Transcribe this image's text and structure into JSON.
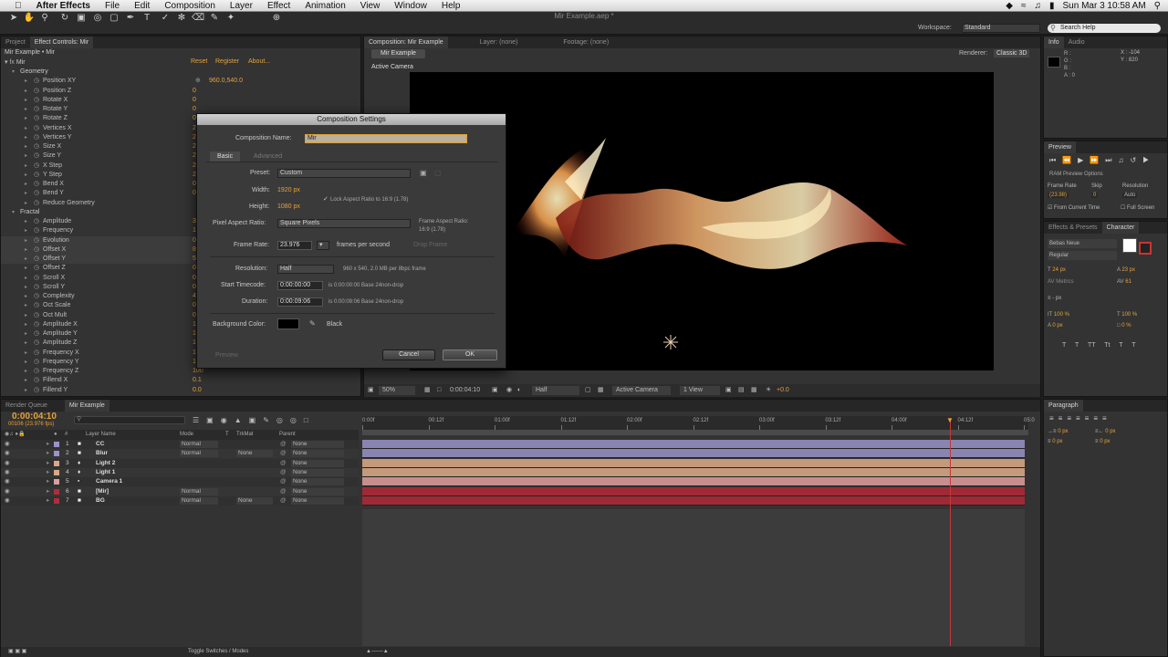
{
  "menubar": {
    "apple": "",
    "app_name": "After Effects",
    "items": [
      "File",
      "Edit",
      "Composition",
      "Layer",
      "Effect",
      "Animation",
      "View",
      "Window",
      "Help"
    ],
    "clock": "Sun Mar 3  10:58 AM",
    "window_title": "Mir Example.aep *"
  },
  "toolbar": {
    "workspace_label": "Workspace:",
    "workspace_value": "Standard",
    "search_placeholder": "Search Help"
  },
  "effect_controls": {
    "tab_project": "Project",
    "tab_effect_controls": "Effect Controls: Mir",
    "header": "Mir Example • Mir",
    "effect_name": "Mir",
    "reset": "Reset",
    "register": "Register",
    "about": "About...",
    "rows": [
      {
        "name": "Geometry",
        "val": "",
        "indent": 1,
        "group": true
      },
      {
        "name": "Position XY",
        "val": "960.0,540.0",
        "indent": 3
      },
      {
        "name": "Position Z",
        "val": "0",
        "indent": 3
      },
      {
        "name": "Rotate X",
        "val": "0",
        "indent": 3
      },
      {
        "name": "Rotate Y",
        "val": "0",
        "indent": 3
      },
      {
        "name": "Rotate Z",
        "val": "0",
        "indent": 3
      },
      {
        "name": "Vertices X",
        "val": "2",
        "indent": 3
      },
      {
        "name": "Vertices Y",
        "val": "2",
        "indent": 3
      },
      {
        "name": "Size X",
        "val": "2",
        "indent": 3
      },
      {
        "name": "Size Y",
        "val": "2",
        "indent": 3
      },
      {
        "name": "X Step",
        "val": "2",
        "indent": 3
      },
      {
        "name": "Y Step",
        "val": "2",
        "indent": 3
      },
      {
        "name": "Bend X",
        "val": "0",
        "indent": 3
      },
      {
        "name": "Bend Y",
        "val": "0",
        "indent": 3
      },
      {
        "name": "Reduce Geometry",
        "val": "",
        "indent": 3
      },
      {
        "name": "Fractal",
        "val": "",
        "indent": 1,
        "group": true
      },
      {
        "name": "Amplitude",
        "val": "3",
        "indent": 3
      },
      {
        "name": "Frequency",
        "val": "1",
        "indent": 3
      },
      {
        "name": "Evolution",
        "val": "0",
        "indent": 3
      },
      {
        "name": "Offset X",
        "val": "8",
        "indent": 3
      },
      {
        "name": "Offset Y",
        "val": "5",
        "indent": 3
      },
      {
        "name": "Offset Z",
        "val": "0",
        "indent": 3
      },
      {
        "name": "Scroll X",
        "val": "0",
        "indent": 3
      },
      {
        "name": "Scroll Y",
        "val": "0",
        "indent": 3
      },
      {
        "name": "Complexity",
        "val": "4",
        "indent": 3
      },
      {
        "name": "Oct Scale",
        "val": "0",
        "indent": 3
      },
      {
        "name": "Oct Mult",
        "val": "0",
        "indent": 3
      },
      {
        "name": "Amplitude X",
        "val": "1",
        "indent": 3
      },
      {
        "name": "Amplitude Y",
        "val": "1",
        "indent": 3
      },
      {
        "name": "Amplitude Z",
        "val": "1",
        "indent": 3
      },
      {
        "name": "Frequency X",
        "val": "1",
        "indent": 3
      },
      {
        "name": "Frequency Y",
        "val": "1",
        "indent": 3
      },
      {
        "name": "Frequency Z",
        "val": "100",
        "indent": 3
      },
      {
        "name": "Fillend X",
        "val": "0.1",
        "indent": 3
      },
      {
        "name": "Fillend Y",
        "val": "0.0",
        "indent": 3
      }
    ]
  },
  "composition": {
    "tab": "Composition: Mir Example",
    "layer_tab": "Layer: (none)",
    "footage_tab": "Footage: (none)",
    "breadcrumb": "Mir Example",
    "renderer_label": "Renderer:",
    "renderer_value": "Classic 3D",
    "active_camera": "Active Camera",
    "footer": {
      "zoom": "50%",
      "timecode": "0:00:04:10",
      "resolution": "Half",
      "view": "Active Camera",
      "views": "1 View",
      "exposure": "+0.0"
    }
  },
  "dialog": {
    "title": "Composition Settings",
    "comp_name_label": "Composition Name:",
    "comp_name_value": "Mir",
    "tab_basic": "Basic",
    "tab_advanced": "Advanced",
    "preset_label": "Preset:",
    "preset_value": "Custom",
    "width_label": "Width:",
    "width_value": "1920 px",
    "height_label": "Height:",
    "height_value": "1080 px",
    "lock_label": "Lock Aspect Ratio to 16:9 (1.78)",
    "par_label": "Pixel Aspect Ratio:",
    "par_value": "Square Pixels",
    "far_label": "Frame Aspect Ratio:",
    "far_value": "16:9 (1.78)",
    "fps_label": "Frame Rate:",
    "fps_value": "23.976",
    "fps_unit": "frames per second",
    "drop_frame": "Drop Frame",
    "res_label": "Resolution:",
    "res_value": "Half",
    "res_info": "960 x 540, 2.0 MB per 8bpc frame",
    "start_label": "Start Timecode:",
    "start_value": "0:00:00:00",
    "start_info": "is 0:00:00:00  Base 24non-drop",
    "dur_label": "Duration:",
    "dur_value": "0:00:09:06",
    "dur_info": "is 0:00:09:06  Base 24non-drop",
    "bg_label": "Background Color:",
    "bg_name": "Black",
    "preview": "Preview",
    "cancel": "Cancel",
    "ok": "OK"
  },
  "right_panel": {
    "info_tab": "Info",
    "audio_tab": "Audio",
    "info_rgb": [
      "R :",
      "G :",
      "B :",
      "A : 0"
    ],
    "info_x": "X : -104",
    "info_y": "Y : 820",
    "preview_tab": "Preview",
    "ram_preview": "RAM Preview Options",
    "frame_rate_label": "Frame Rate",
    "skip_label": "Skip",
    "resolution_label": "Resolution",
    "frame_rate_value": "(23.98)",
    "skip_value": "0",
    "resolution_value": "Auto",
    "from_current": "From Current Time",
    "full_screen": "Full Screen",
    "effects_tab": "Effects & Presets",
    "character_tab": "Character",
    "font": "Bebas Neue",
    "style": "Regular",
    "size": "24 px",
    "leading": "23 px",
    "kerning": "Metrics",
    "tracking": "61",
    "stroke": "- px",
    "vscale": "100 %",
    "hscale": "100 %",
    "baseline": "0 px",
    "tsume": "0 %",
    "text_styles": [
      "T",
      "T",
      "TT",
      "Tt",
      "T",
      "T"
    ],
    "paragraph_tab": "Paragraph",
    "para_values": [
      "0 px",
      "0 px",
      "0 px",
      "0 px",
      "0 px"
    ]
  },
  "timeline": {
    "render_queue_tab": "Render Queue",
    "comp_tab": "Mir Example",
    "timecode": "0:00:04:10",
    "frame_info": "00106 (23.976 fps)",
    "col_layer": "Layer Name",
    "col_mode": "Mode",
    "col_t": "T",
    "col_trkmat": "TrkMat",
    "col_parent": "Parent",
    "ruler": [
      "0:00f",
      "00:12f",
      "01:00f",
      "01:12f",
      "02:00f",
      "02:12f",
      "03:00f",
      "03:12f",
      "04:00f",
      "04:12f",
      "05:0"
    ],
    "playhead_fraction": 0.887,
    "toggle": "Toggle Switches / Modes",
    "layers": [
      {
        "num": "1",
        "name": "CC",
        "color": "#9a92c8",
        "mode": "Normal",
        "trkmat": "",
        "parent": "None",
        "bar": "#8984b0",
        "icon": "solid"
      },
      {
        "num": "2",
        "name": "Blur",
        "color": "#9a92c8",
        "mode": "Normal",
        "trkmat": "None",
        "parent": "None",
        "bar": "#8984b0",
        "icon": "solid"
      },
      {
        "num": "3",
        "name": "Light 2",
        "color": "#d8a887",
        "mode": "",
        "trkmat": "",
        "parent": "None",
        "bar": "#c49a7c",
        "icon": "light"
      },
      {
        "num": "4",
        "name": "Light 1",
        "color": "#d8a887",
        "mode": "",
        "trkmat": "",
        "parent": "None",
        "bar": "#c49a7c",
        "icon": "light"
      },
      {
        "num": "5",
        "name": "Camera 1",
        "color": "#d8a0a0",
        "mode": "",
        "trkmat": "",
        "parent": "None",
        "bar": "#c78e8e",
        "icon": "camera"
      },
      {
        "num": "6",
        "name": "[Mir]",
        "color": "#b02c3a",
        "mode": "Normal",
        "trkmat": "",
        "parent": "None",
        "bar": "#9f2a36",
        "icon": "solid"
      },
      {
        "num": "7",
        "name": "BG",
        "color": "#b02c3a",
        "mode": "Normal",
        "trkmat": "None",
        "parent": "None",
        "bar": "#9f2a36",
        "icon": "solid"
      }
    ]
  },
  "colors": {
    "accent_orange": "#e5a23a",
    "playhead": "#c13a3a",
    "panel_bg": "#333333"
  }
}
